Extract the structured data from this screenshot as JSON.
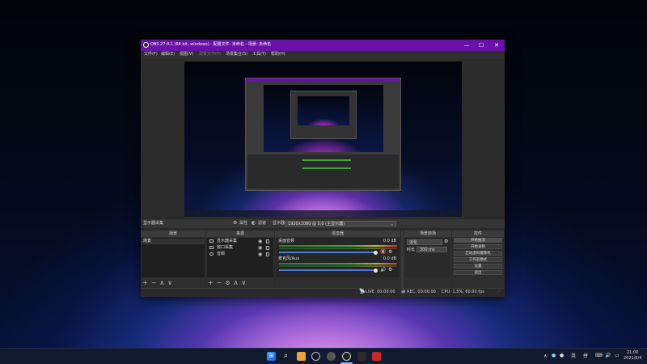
{
  "window": {
    "title": "OBS 27.0.1 (64 bit, windows) - 配置文件: 未命名 - 场景: 未命名",
    "min_glyph": "—",
    "max_glyph": "☐",
    "close_glyph": "✕",
    "title_color": "#6a11a8"
  },
  "menu": [
    "文件(F)",
    "编辑(E)",
    "视图(V)",
    "配置文件(P)",
    "场景集合(S)",
    "工具(T)",
    "帮助(H)"
  ],
  "context_bar": {
    "source_name": "显示器采集",
    "properties_label": "属性",
    "filters_label": "滤镜",
    "display_label": "显示器",
    "display_value": "1920x1080 @ 0,0 (主显示器)"
  },
  "docks": {
    "scenes": {
      "title": "场景",
      "items": [
        "场景"
      ]
    },
    "sources": {
      "title": "来源",
      "items": [
        {
          "label": "显示器采集",
          "icon": "monitor-icon"
        },
        {
          "label": "窗口采集",
          "icon": "window-icon"
        },
        {
          "label": "音频",
          "icon": "speaker-icon"
        }
      ]
    },
    "mixer": {
      "title": "混音器",
      "tracks": [
        {
          "name": "桌面音频",
          "db": "0.0 dB"
        },
        {
          "name": "麦克风/Aux",
          "db": "0.0 dB"
        }
      ]
    },
    "transitions": {
      "title": "场景转场",
      "type": "淡化",
      "duration_label": "时长",
      "duration_value": "300 ms"
    },
    "controls": {
      "title": "控件",
      "buttons": [
        "开始推流",
        "开始录制",
        "启动虚拟摄像机",
        "工作室模式",
        "设置",
        "退出"
      ]
    }
  },
  "status": {
    "live": "LIVE: 00:00:00",
    "rec": "REC: 00:00:00",
    "cpu": "CPU: 1.5%, 60.00 fps"
  },
  "tray": {
    "ime": "英",
    "ime2": "拼",
    "time": "21:00",
    "date": "2021/6/4"
  },
  "taskbar_icons": [
    "windows-start-icon",
    "search-icon",
    "files-icon",
    "store-icon",
    "settings-icon",
    "obs-icon",
    "chrome-icon",
    "app-icon"
  ]
}
